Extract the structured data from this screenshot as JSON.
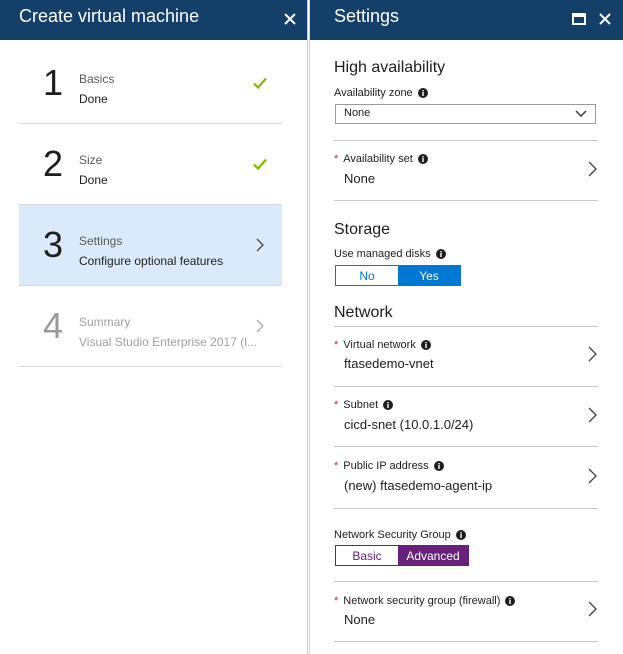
{
  "left_blade": {
    "title": "Create virtual machine",
    "steps": [
      {
        "number": "1",
        "title": "Basics",
        "subtitle": "Done",
        "state": "done"
      },
      {
        "number": "2",
        "title": "Size",
        "subtitle": "Done",
        "state": "done"
      },
      {
        "number": "3",
        "title": "Settings",
        "subtitle": "Configure optional features",
        "state": "active"
      },
      {
        "number": "4",
        "title": "Summary",
        "subtitle": "Visual Studio Enterprise 2017 (l...",
        "state": "disabled"
      }
    ]
  },
  "right_blade": {
    "title": "Settings",
    "high_availability": {
      "section_title": "High availability",
      "availability_zone_label": "Availability zone",
      "availability_zone_value": "None",
      "availability_set_label": "Availability set",
      "availability_set_value": "None"
    },
    "storage": {
      "section_title": "Storage",
      "managed_disks_label": "Use managed disks",
      "options": [
        "No",
        "Yes"
      ],
      "selected": "Yes"
    },
    "network": {
      "section_title": "Network",
      "virtual_network_label": "Virtual network",
      "virtual_network_value": "ftasedemo-vnet",
      "subnet_label": "Subnet",
      "subnet_value": "cicd-snet (10.0.1.0/24)",
      "public_ip_label": "Public IP address",
      "public_ip_value": "(new) ftasedemo-agent-ip",
      "nsg_label": "Network Security Group",
      "nsg_options": [
        "Basic",
        "Advanced"
      ],
      "nsg_selected": "Advanced",
      "nsg_firewall_label": "Network security group (firewall)",
      "nsg_firewall_value": "None"
    }
  },
  "colors": {
    "header_bg": "#133f68",
    "active_step_bg": "#daeafa",
    "check_green": "#7fba00",
    "toggle_blue": "#0078d4",
    "toggle_purple": "#68217a",
    "required_red": "#c4262e"
  },
  "icons": [
    "close-icon",
    "maximize-icon",
    "checkmark-icon",
    "chevron-right-icon",
    "chevron-down-icon",
    "info-icon"
  ]
}
